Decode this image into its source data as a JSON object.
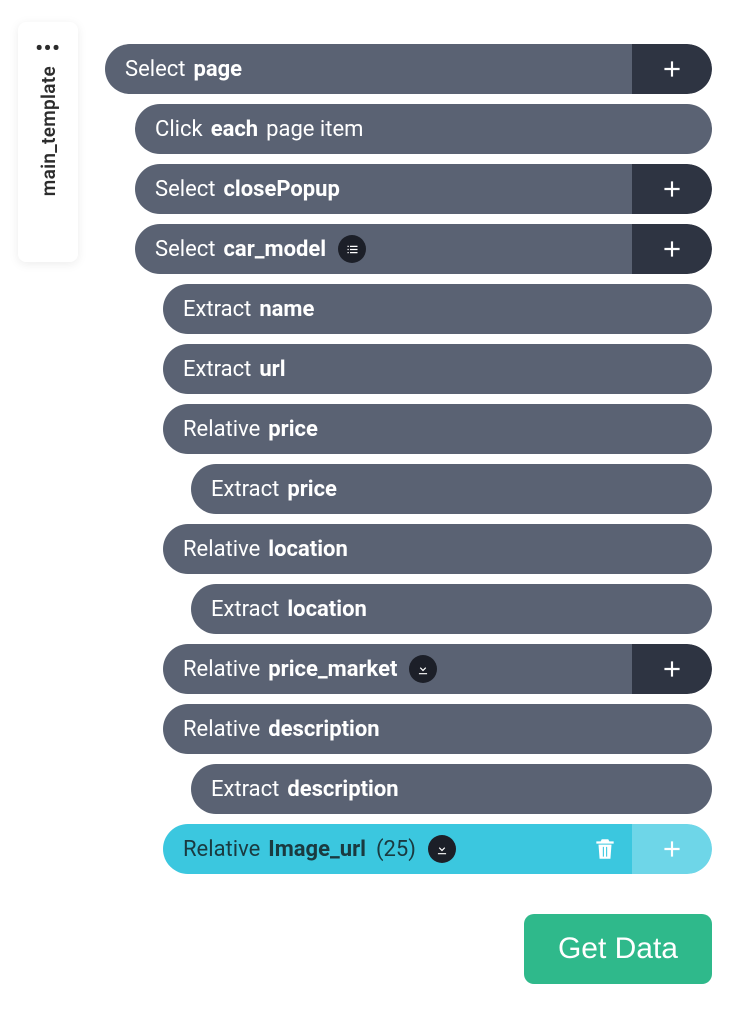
{
  "sidebar": {
    "ellipsis": "•••",
    "tab_label": "main_template"
  },
  "rows": {
    "select_page": {
      "prefix": "Select",
      "value": "page"
    },
    "click_each": {
      "prefix": "Click",
      "bold": "each",
      "suffix": "page item"
    },
    "select_close_popup": {
      "prefix": "Select",
      "value": "closePopup"
    },
    "select_car_model": {
      "prefix": "Select",
      "value": "car_model"
    },
    "extract_name": {
      "prefix": "Extract",
      "value": "name"
    },
    "extract_url": {
      "prefix": "Extract",
      "value": "url"
    },
    "relative_price": {
      "prefix": "Relative",
      "value": "price"
    },
    "extract_price": {
      "prefix": "Extract",
      "value": "price"
    },
    "relative_location": {
      "prefix": "Relative",
      "value": "location"
    },
    "extract_location": {
      "prefix": "Extract",
      "value": "location"
    },
    "relative_price_market": {
      "prefix": "Relative",
      "value": "price_market"
    },
    "relative_description": {
      "prefix": "Relative",
      "value": "description"
    },
    "extract_description": {
      "prefix": "Extract",
      "value": "description"
    },
    "relative_image_url": {
      "prefix": "Relative",
      "value": "Image_url",
      "count": "(25)"
    }
  },
  "buttons": {
    "get_data": "Get Data"
  }
}
